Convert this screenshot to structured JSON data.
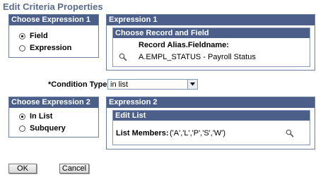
{
  "page": {
    "title": "Edit Criteria Properties"
  },
  "expr1_type": {
    "header": "Choose Expression 1 Type",
    "options": [
      {
        "label": "Field",
        "checked": true
      },
      {
        "label": "Expression",
        "checked": false
      }
    ]
  },
  "expr1": {
    "header": "Expression 1",
    "sub_header": "Choose Record and Field",
    "field_label": "Record Alias.Fieldname:",
    "field_value": "A.EMPL_STATUS - Payroll Status",
    "lookup_icon": "magnifier-icon"
  },
  "condition": {
    "label": "*Condition Type:",
    "selected": "in list"
  },
  "expr2_type": {
    "header": "Choose Expression 2 Type",
    "options": [
      {
        "label": "In List",
        "checked": true
      },
      {
        "label": "Subquery",
        "checked": false
      }
    ]
  },
  "expr2": {
    "header": "Expression 2",
    "sub_header": "Edit List",
    "list_label": "List Members:",
    "list_value": "('A','L','P','S','W')",
    "lookup_icon": "magnifier-icon"
  },
  "buttons": {
    "ok": "OK",
    "cancel": "Cancel"
  },
  "colors": {
    "header_bg": "#4C5F8B",
    "title": "#5A6B8C",
    "border": "#6A7FA8"
  }
}
